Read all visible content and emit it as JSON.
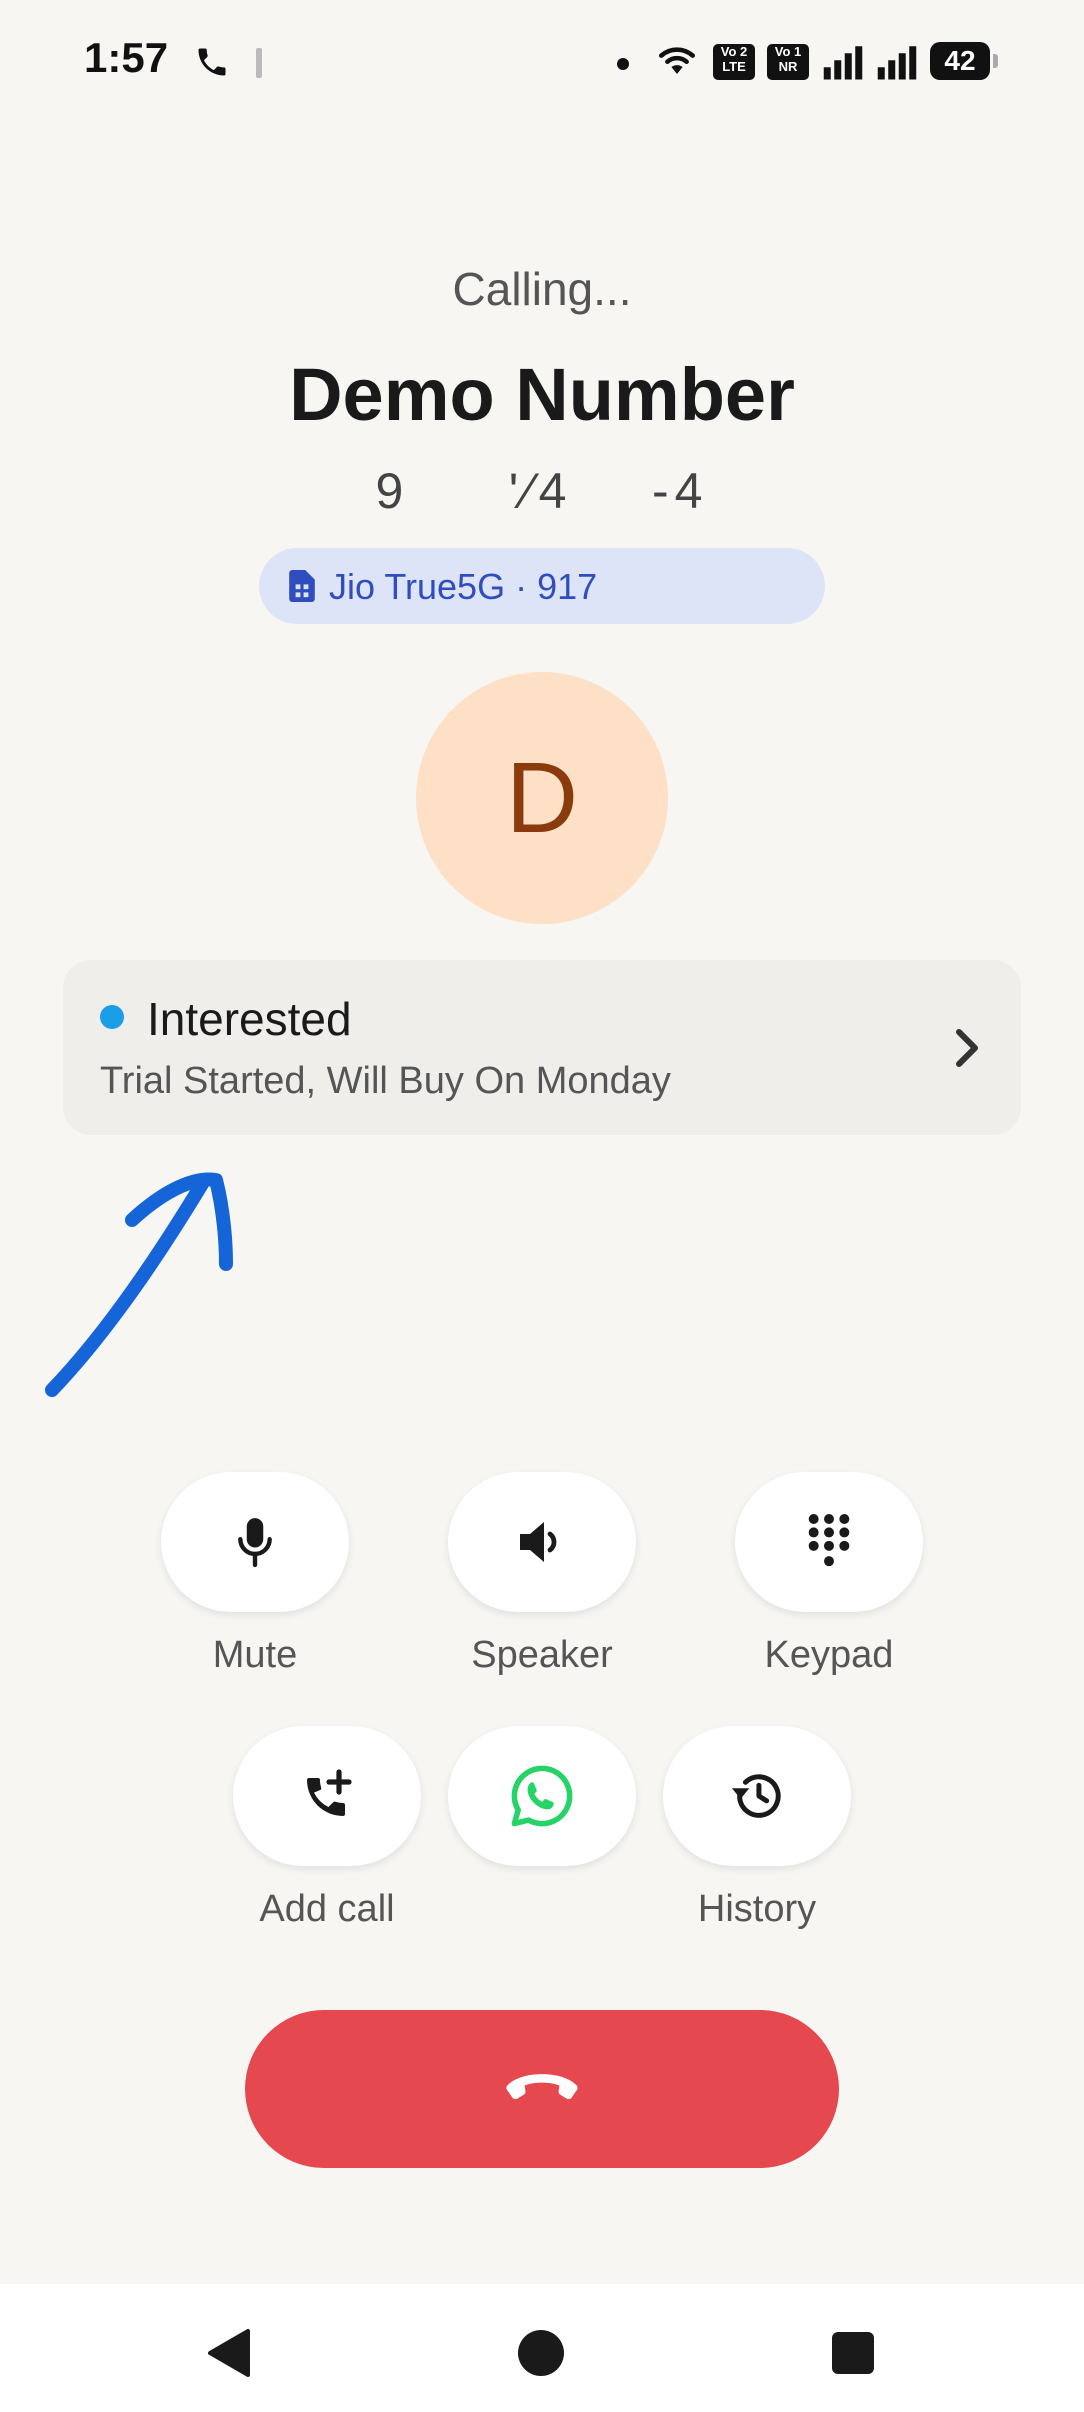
{
  "status_bar": {
    "time": "1:57",
    "volte_label": "Vo 2 LTE",
    "vonr_label": "Vo 1 NR",
    "battery": "42"
  },
  "call": {
    "state": "Calling...",
    "contact_name": "Demo Number",
    "number": "9     '⁄4    -4",
    "sim_label": "Jio True5G · 917",
    "avatar_letter": "D"
  },
  "lead_status": {
    "title": "Interested",
    "note": "Trial Started, Will Buy On Monday",
    "dot_color": "#1a9ee6"
  },
  "controls": {
    "mute": "Mute",
    "speaker": "Speaker",
    "keypad": "Keypad",
    "add_call": "Add call",
    "history": "History"
  },
  "colors": {
    "end_call": "#e5484f",
    "whatsapp": "#25d366",
    "annotation": "#1565d8",
    "sim_text": "#2f4dbf"
  }
}
